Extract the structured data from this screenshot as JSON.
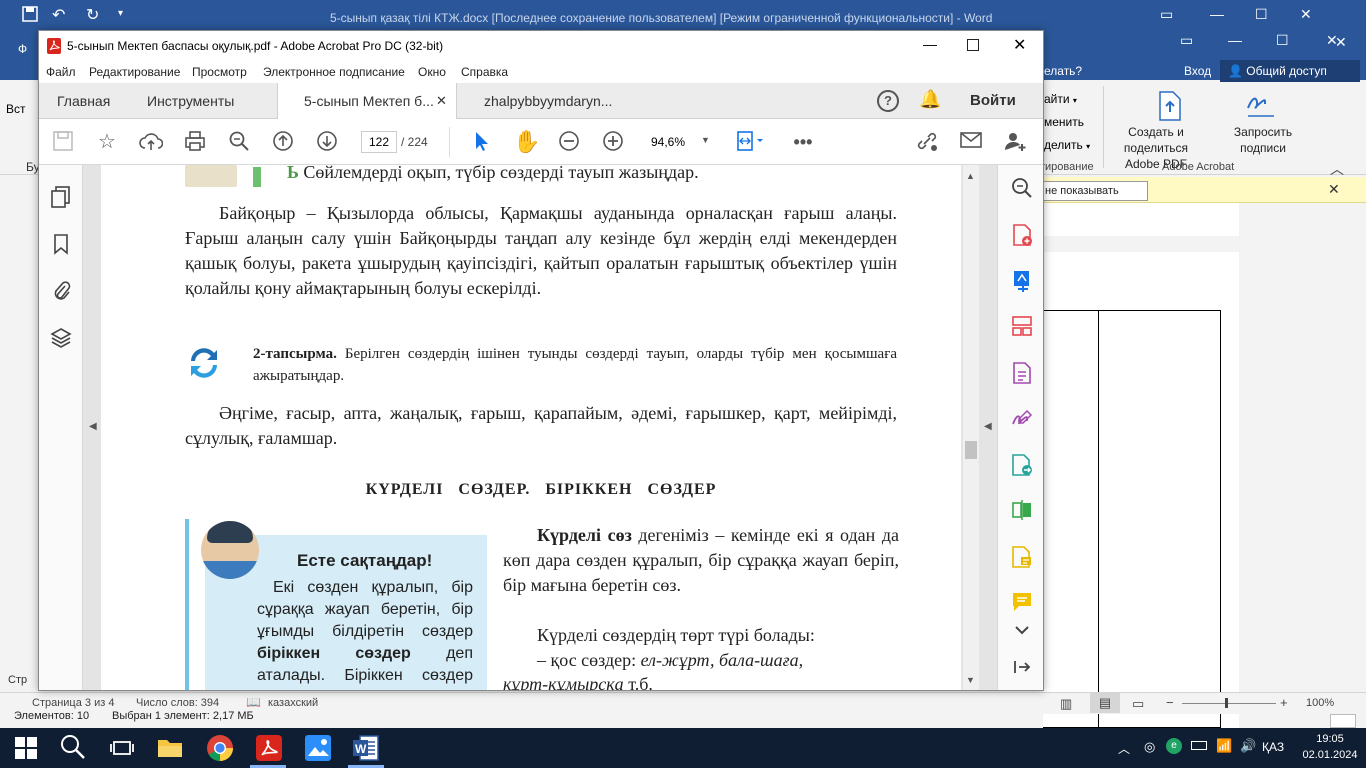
{
  "word": {
    "title": "5-сынып қазақ тілі КТЖ.docx [Последнее сохранение пользователем] [Режим ограниченной функциональности] - Word",
    "help": "елать?",
    "signin": "Вход",
    "share": "Общий доступ",
    "ribbon": {
      "item1": "айти",
      "item2": "менить",
      "item3": "делить",
      "group1": "тирование",
      "create_pdf": "Создать и поделиться Adobe PDF",
      "request_sign": "Запросить подписи",
      "group2": "Adobe Acrobat"
    },
    "msg_button": "не показывать",
    "left_partial_1": "Ф",
    "left_partial_2": "Вст",
    "left_partial_3": "Бу",
    "left_partial_4": "Стр",
    "status": {
      "page": "Страница 3 из 4",
      "words": "Число слов: 394",
      "lang": "казахский",
      "zoom": "100%"
    },
    "explorer_status": {
      "elements": "Элементов: 10",
      "selected": "Выбран 1 элемент: 2,17 МБ"
    }
  },
  "acrobat": {
    "title": "5-сынып Мектеп баспасы оқулық.pdf - Adobe Acrobat Pro DC (32-bit)",
    "menu": [
      "Файл",
      "Редактирование",
      "Просмотр",
      "Электронное подписание",
      "Окно",
      "Справка"
    ],
    "tabs": {
      "home": "Главная",
      "tools": "Инструменты",
      "doc1": "5-сынып Мектеп б...",
      "doc2": "zhalpybbyymdaryn..."
    },
    "signin": "Войти",
    "page_current": "122",
    "page_total": "/ 224",
    "zoom": "94,6%",
    "pdf": {
      "line_top": "Сөйлемдерді оқып, түбір сөздерді тауып жазыңдар.",
      "para1": "Байқоңыр – Қызылорда облысы, Қармақшы ауданында орналасқан ғарыш алаңы. Ғарыш алаңын салу үшін Байқоңырды таңдап алу кезінде бұл жердің елді мекендерден қашық болуы, ракета ұшырудың қауіпсіздігі, қайтып оралатын ғарыштық объектілер үшін қолайлы қону аймақтарының болуы ескерілді.",
      "task2_label": "2-тапсырма.",
      "task2_text": "Берілген сөздердің ішінен туынды сөздерді тауып, оларды түбір мен қосымшаға ажыратыңдар.",
      "words": "Әңгіме, ғасыр, апта, жаңалық, ғарыш, қарапайым, әдемі, ғарышкер, қарт, мейірімді, сұлулық, ғаламшар.",
      "heading": "КҮРДЕЛІ СӨЗДЕР. БІРІККЕН СӨЗДЕР",
      "box_title": "Есте сақтаңдар!",
      "box_text_1": "Екі сөзден құралып, бір сұраққа жауап беретін, бір ұғымды білдіретін сөздер",
      "box_bold": "біріккен сөздер",
      "box_text_2": "деп аталады. Біріккен сөздер бір-",
      "right_bold": "Күрделі сөз",
      "right_p1": "дегеніміз – кемінде екі я одан да көп дара сөзден құралып, бір сұраққа жауап беріп, бір мағына беретін сөз.",
      "right_p2": "Күрделі сөздердің төрт түрі болады:",
      "right_p3a": "– қос сөздер:",
      "right_p3b": "ел-жұрт, бала-шаға,",
      "right_p4a": "құрт-құмырсқа",
      "right_p4b": "т.б."
    }
  },
  "taskbar": {
    "lang": "ҚАЗ",
    "time": "19:05",
    "date": "02.01.2024"
  }
}
